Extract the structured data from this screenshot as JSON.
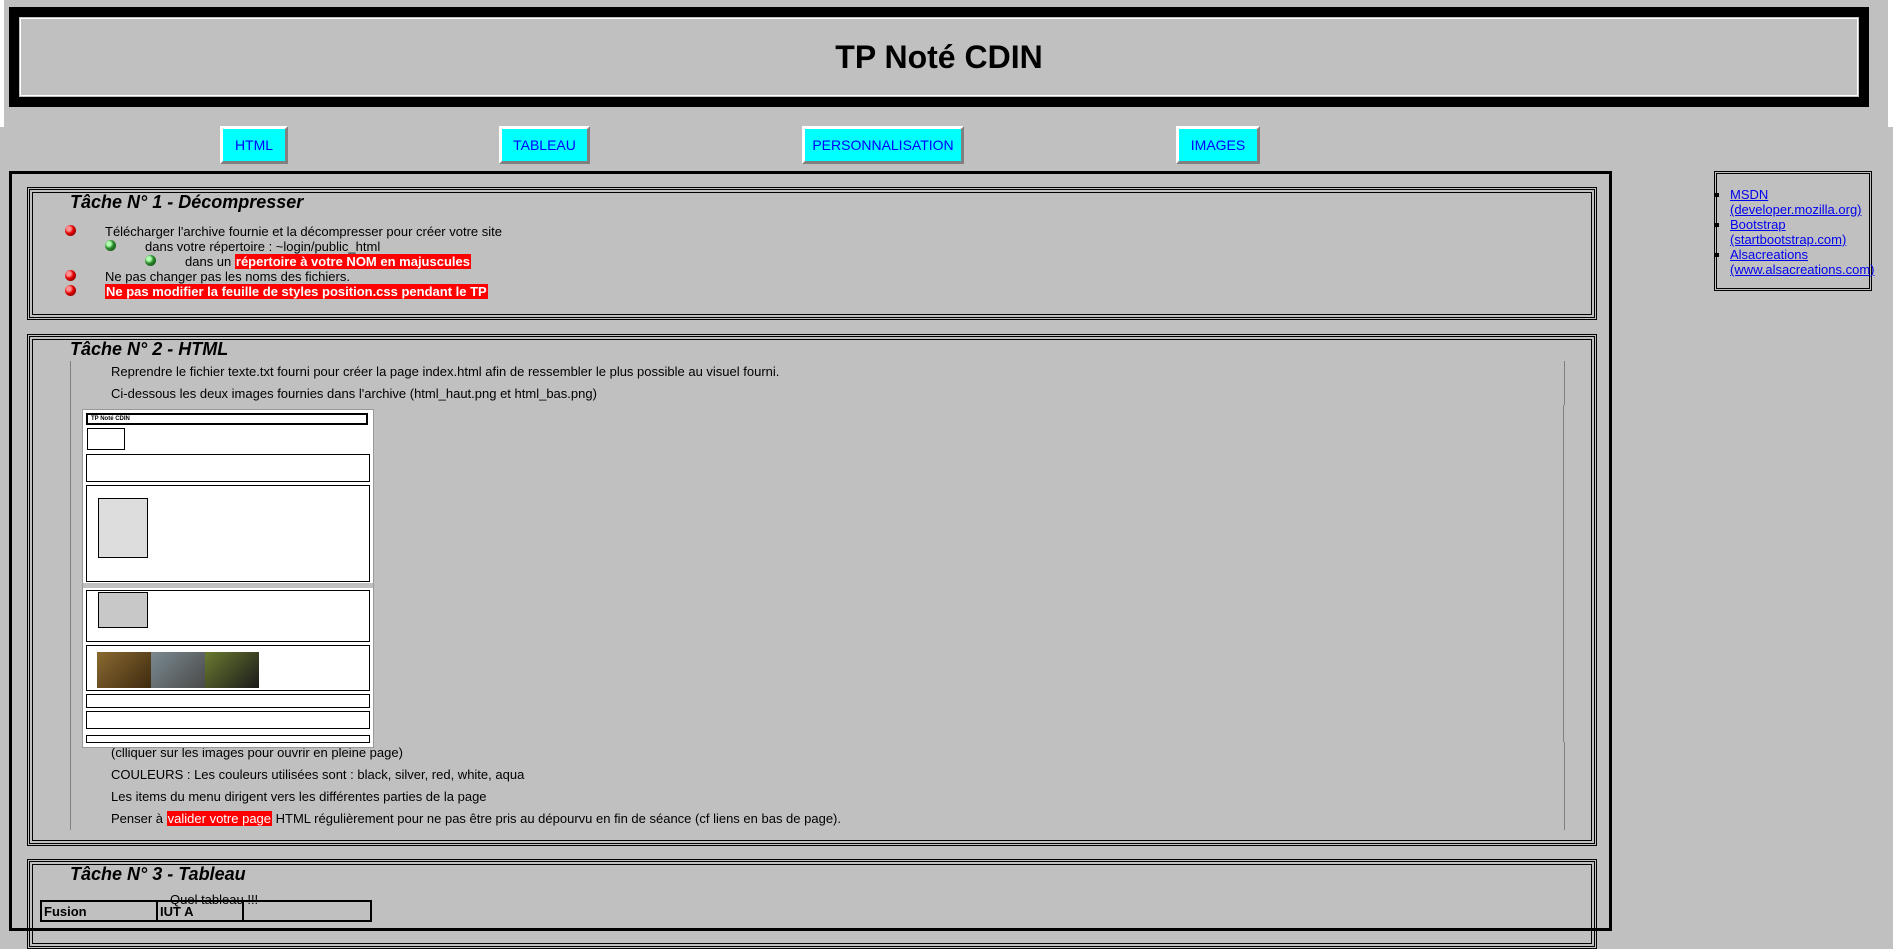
{
  "header": {
    "title": "TP Noté CDIN"
  },
  "menu": [
    {
      "label": "HTML"
    },
    {
      "label": "TABLEAU"
    },
    {
      "label": "PERSONNALISATION"
    },
    {
      "label": "IMAGES"
    }
  ],
  "tache1": {
    "title": "Tâche N° 1 - Décompresser",
    "item1": "Télécharger l'archive fournie et la décompresser pour créer votre site",
    "sub1": "dans votre répertoire : ~login/public_html",
    "sub2_prefix": "dans un",
    "sub2_highlight": "répertoire à votre NOM en majuscules",
    "item2": "Ne pas changer pas les noms des fichiers.",
    "item3_highlight": "Ne pas modifier la feuille de styles position.css pendant le TP"
  },
  "tache2": {
    "title": "Tâche N° 2 - HTML",
    "row1": "Reprendre le fichier texte.txt fourni pour créer la page index.html afin de ressembler le plus possible au visuel fourni.",
    "row2": "Ci-dessous les deux images fournies dans l'archive (html_haut.png et html_bas.png)",
    "row3": "(clliquer sur les images pour ouvrir en pleine page)",
    "row4": "COULEURS : Les couleurs utilisées sont : black, silver, red, white, aqua",
    "row5": "Les items du menu dirigent vers les différentes parties de la page",
    "row6_prefix": "Penser à",
    "row6_highlight": "valider votre page",
    "row6_suffix": "HTML régulièrement pour ne pas être pris au dépourvu en fin de séance (cf liens en bas de page).",
    "thumb": {
      "title": "TP Noté CDIN"
    }
  },
  "tache3": {
    "title": "Tâche N° 3 - Tableau",
    "caption": "Quel tableau !!!",
    "cells": [
      "Fusion",
      "IUT A",
      ""
    ]
  },
  "sidebar": {
    "links": [
      {
        "name": "MSDN",
        "url": "(developer.mozilla.org)"
      },
      {
        "name": "Bootstrap",
        "url": "(startbootstrap.com)"
      },
      {
        "name": "Alsacreations",
        "url": "(www.alsacreations.com)"
      }
    ]
  },
  "colors": {
    "background": "#c0c0c0",
    "menu": "#00ffff",
    "highlight": "#ff0000",
    "link": "#0000ee"
  }
}
